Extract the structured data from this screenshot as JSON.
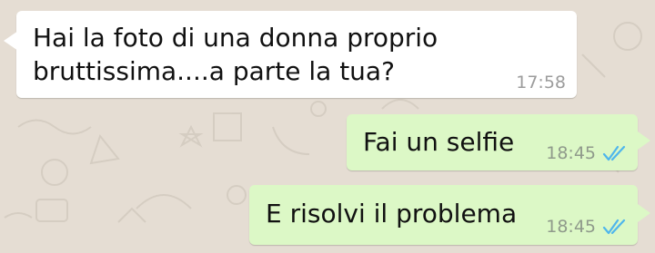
{
  "chat": {
    "messages": [
      {
        "direction": "incoming",
        "lines": [
          "Hai la foto di una donna proprio",
          "bruttissima....a parte la tua?"
        ],
        "time": "17:58"
      },
      {
        "direction": "outgoing",
        "text": "Fai un selfie",
        "time": "18:45",
        "status_icon": "double-check-read-icon"
      },
      {
        "direction": "outgoing",
        "text": "E risolvi il problema",
        "time": "18:45",
        "status_icon": "double-check-read-icon"
      }
    ]
  },
  "colors": {
    "background": "#e5ddd3",
    "incoming_bubble": "#ffffff",
    "outgoing_bubble": "#dcf8c6",
    "read_ticks": "#4fb6ec",
    "timestamp": "#8f9a8b"
  }
}
